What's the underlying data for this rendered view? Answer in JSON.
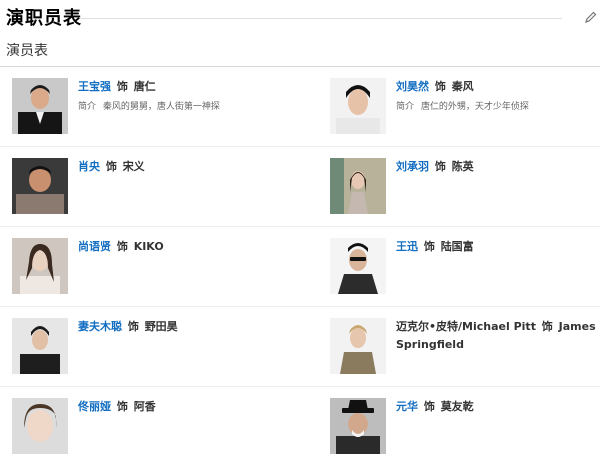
{
  "section": {
    "title": "演职员表",
    "edit_icon": "pencil-icon",
    "subtitle": "演员表"
  },
  "cast": [
    {
      "actor": "王宝强",
      "as": "饰",
      "role": "唐仁",
      "desc_label": "简介",
      "desc": "秦风的舅舅，唐人街第一神探"
    },
    {
      "actor": "刘昊然",
      "as": "饰",
      "role": "秦风",
      "desc_label": "简介",
      "desc": "唐仁的外甥，天才少年侦探"
    },
    {
      "actor": "肖央",
      "as": "饰",
      "role": "宋义",
      "desc_label": "",
      "desc": ""
    },
    {
      "actor": "刘承羽",
      "as": "饰",
      "role": "陈英",
      "desc_label": "",
      "desc": ""
    },
    {
      "actor": "尚语贤",
      "as": "饰",
      "role": "KIKO",
      "desc_label": "",
      "desc": ""
    },
    {
      "actor": "王迅",
      "as": "饰",
      "role": "陆国富",
      "desc_label": "",
      "desc": ""
    },
    {
      "actor": "妻夫木聪",
      "as": "饰",
      "role": "野田昊",
      "desc_label": "",
      "desc": ""
    },
    {
      "actor": "迈克尔•皮特/Michael Pitt",
      "as": "饰",
      "role": "James Springfield",
      "desc_label": "",
      "desc": ""
    },
    {
      "actor": "佟丽娅",
      "as": "饰",
      "role": "阿香",
      "desc_label": "",
      "desc": ""
    },
    {
      "actor": "元华",
      "as": "饰",
      "role": "莫友乾",
      "desc_label": "",
      "desc": ""
    }
  ]
}
